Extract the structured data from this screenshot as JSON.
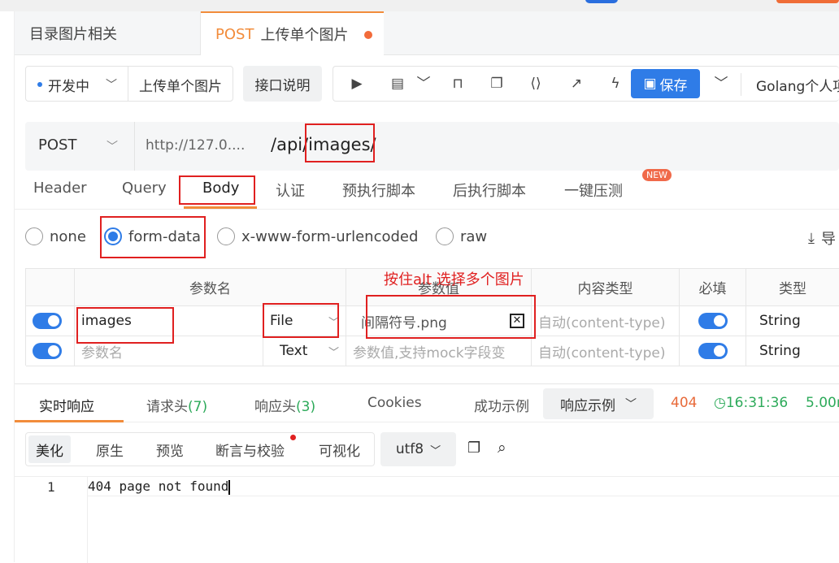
{
  "tabs": [
    {
      "label": "目录图片相关"
    },
    {
      "method": "POST",
      "label": "上传单个图片"
    }
  ],
  "toolbar": {
    "env": "开发中",
    "api_name": "上传单个图片",
    "doc_btn": "接口说明",
    "save": "保存",
    "team": "Golang个人项"
  },
  "url": {
    "method": "POST",
    "host": "http://127.0....",
    "path": "/api/images/"
  },
  "req_tabs": [
    "Header",
    "Query",
    "Body",
    "认证",
    "预执行脚本",
    "后执行脚本",
    "一键压测"
  ],
  "new_badge": "NEW",
  "body_types": [
    "none",
    "form-data",
    "x-www-form-urlencoded",
    "raw"
  ],
  "import_label": "导",
  "annotation": "按住alt 选择多个图片",
  "table": {
    "headers": [
      "参数名",
      "参数值",
      "内容类型",
      "必填",
      "类型"
    ],
    "rows": [
      {
        "name": "images",
        "kind": "File",
        "value": "间隔符号.png",
        "ctype": "自动(content-type)",
        "type": "String"
      },
      {
        "name": "参数名",
        "kind": "Text",
        "value": "参数值,支持mock字段变",
        "ctype": "自动(content-type)",
        "type": "String"
      }
    ]
  },
  "resp_tabs": {
    "realtime": "实时响应",
    "req_headers": "请求头",
    "req_count": "(7)",
    "resp_headers": "响应头",
    "resp_count": "(3)",
    "cookies": "Cookies",
    "success_example": "成功示例",
    "example_select": "响应示例",
    "status": "404",
    "time": "16:31:36",
    "duration": "5.00r"
  },
  "fmt": [
    "美化",
    "原生",
    "预览",
    "断言与校验",
    "可视化"
  ],
  "encoding": "utf8",
  "editor": {
    "line": "1",
    "content": "404 page not found"
  },
  "colors": {
    "accent": "#2f7ce7",
    "orange": "#f28c3b",
    "red": "#e02020",
    "green": "#2daa5a"
  }
}
